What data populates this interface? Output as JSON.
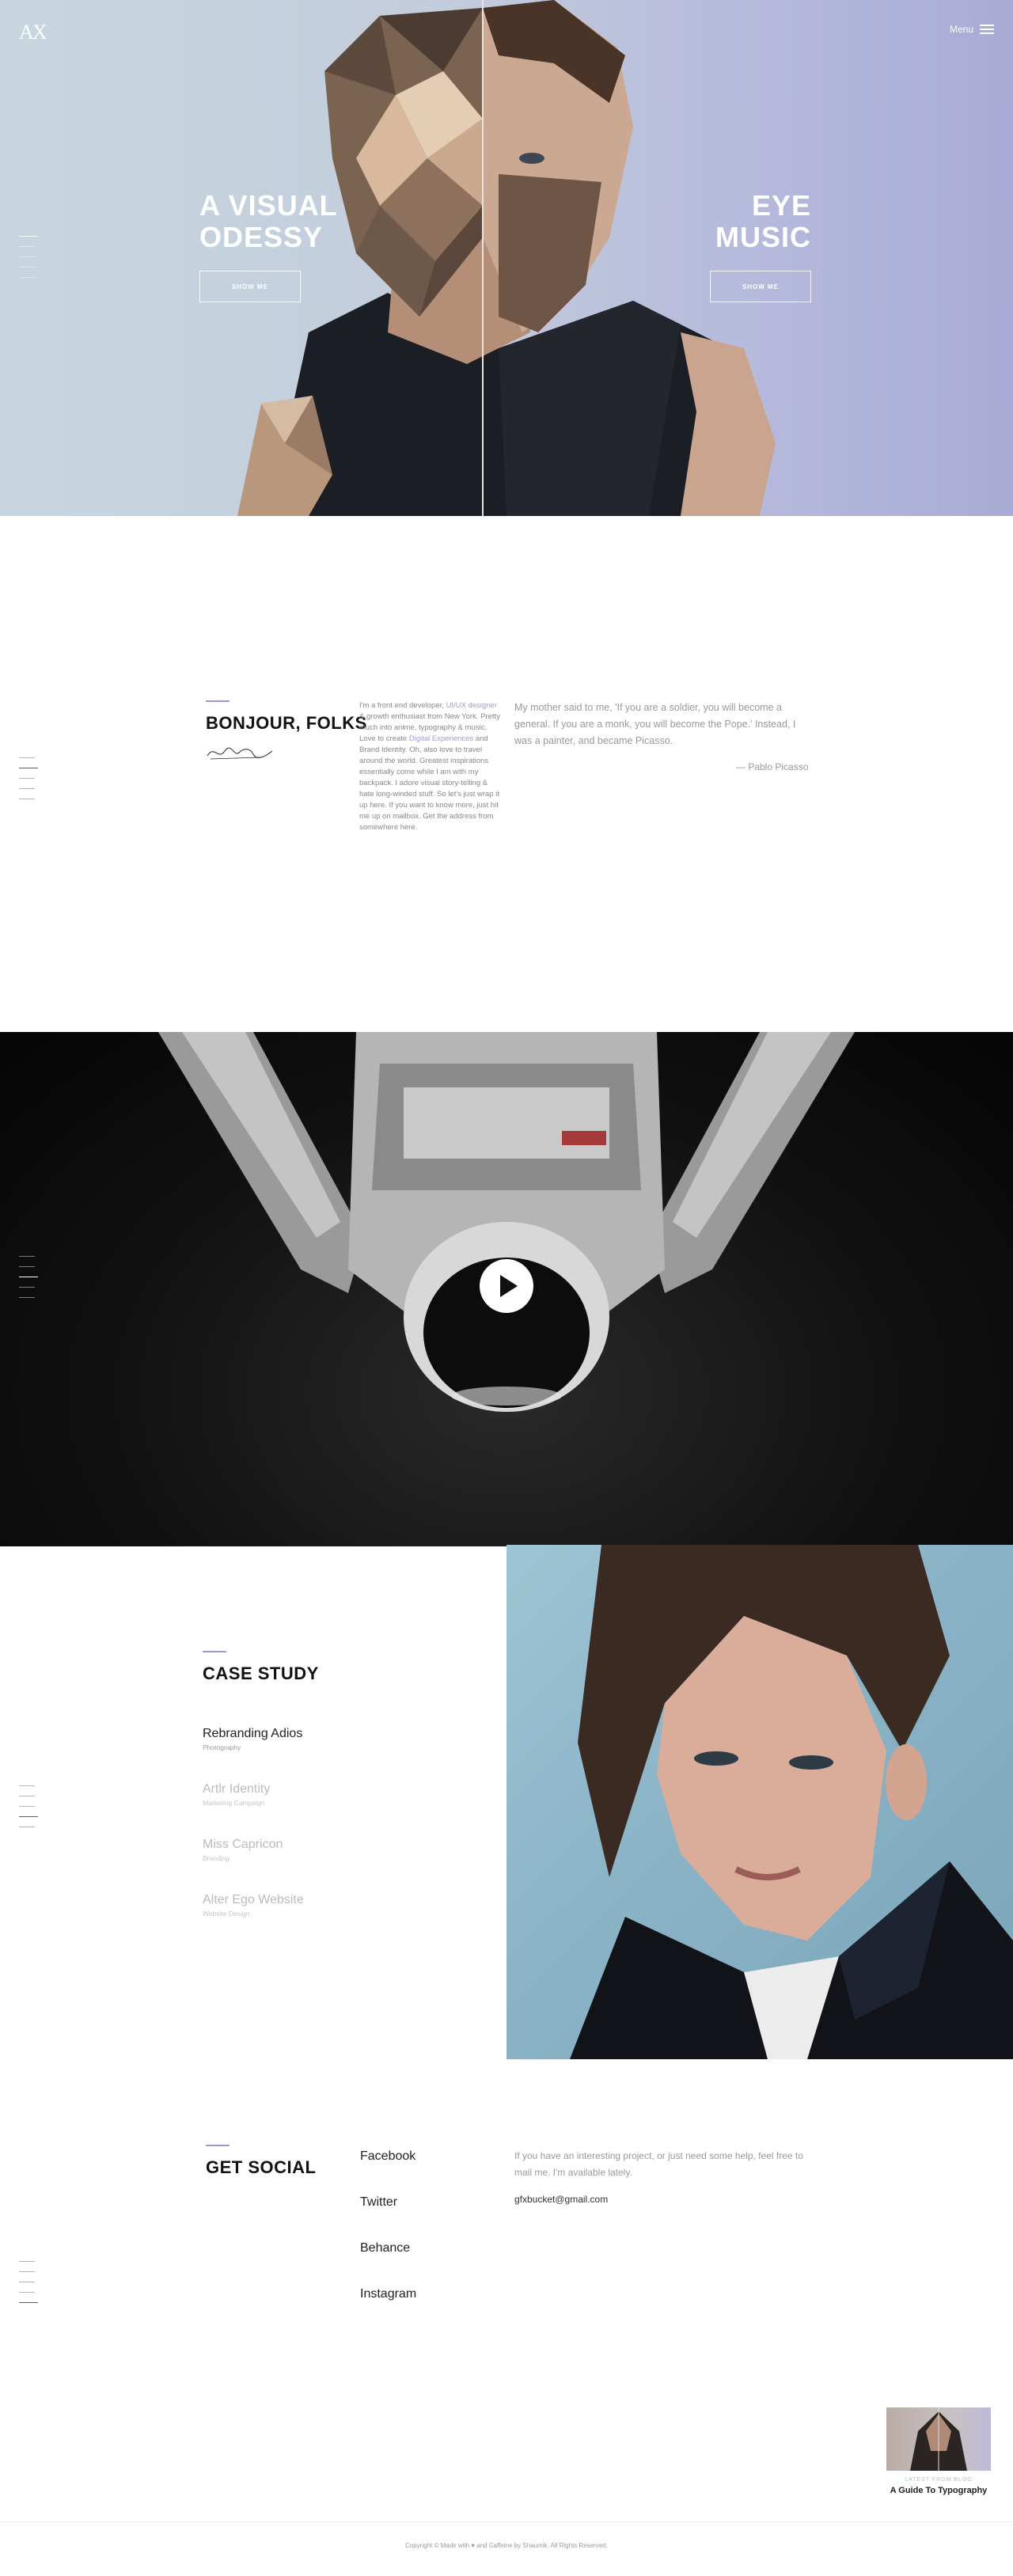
{
  "header": {
    "logo": "AX",
    "menu_label": "Menu"
  },
  "hero": {
    "left_title_line1": "A VISUAL",
    "left_title_line2": "ODESSY",
    "left_button": "SHOW ME",
    "right_title_line1": "EYE",
    "right_title_line2": "MUSIC",
    "right_button": "SHOW ME"
  },
  "about": {
    "heading": "BONJOUR, FOLKS",
    "intro_pre": "I'm a front end developer,",
    "intro_link1": "UI/UX designer",
    "intro_mid1": "& growth enthusiast from New York. Pretty much into anime, typography & music. Love to create",
    "intro_link2": "Digital Experiences",
    "intro_post": "and Brand Identity. Oh, also love to travel around the world. Greatest inspirations essentially come while I am with my backpack. I adore visual story-telling & hate long-winded stuff. So let's just wrap it up here. If you want to know more, just hit me up on mailbox. Get the address from somewhere here.",
    "quote": "My mother said to me, 'If you are a soldier, you will become a general. If you are a monk, you will become the Pope.' Instead, I was a painter, and became Picasso.",
    "quote_author": "— Pablo Picasso"
  },
  "case_study": {
    "heading": "CASE STUDY",
    "items": [
      {
        "title": "Rebranding Adios",
        "subtitle": "Photography"
      },
      {
        "title": "Artlr Identity",
        "subtitle": "Marketing Campaign"
      },
      {
        "title": "Miss Capricon",
        "subtitle": "Branding"
      },
      {
        "title": "Alter Ego Website",
        "subtitle": "Website Design"
      }
    ]
  },
  "social": {
    "heading": "GET SOCIAL",
    "links": [
      "Facebook",
      "Twitter",
      "Behance",
      "Instagram"
    ],
    "contact_text": "If you have an interesting project, or just need some help, feel free to mail me. I'm available lately.",
    "email": "gfxbucket@gmail.com"
  },
  "blog": {
    "label": "LATEST FROM BLOG",
    "title": "A Guide To Typography"
  },
  "footer": {
    "text": "Copyright © Made with ♥ and Caffeine by Shaumik. All Rights Reserved."
  },
  "colors": {
    "accent": "#9a9cd8",
    "hero_left_bg": "#c7d6de",
    "hero_right_bg": "#a9abd6"
  }
}
